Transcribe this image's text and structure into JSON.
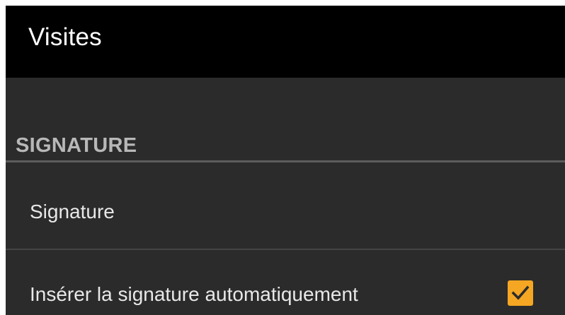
{
  "action_bar": {
    "title": "Visites"
  },
  "section": {
    "header": "SIGNATURE"
  },
  "preferences": {
    "signature": {
      "label": "Signature"
    },
    "auto_insert": {
      "label": "Insérer la signature automatiquement",
      "checked": true,
      "checkbox_color": "#f5a623",
      "checkbox_icon": "checkmark-icon"
    }
  },
  "colors": {
    "background": "#2b2b2b",
    "action_bar": "#000000",
    "section_header_text": "#b8b8b8",
    "item_text": "#e8e8e8",
    "accent": "#f5a623"
  }
}
